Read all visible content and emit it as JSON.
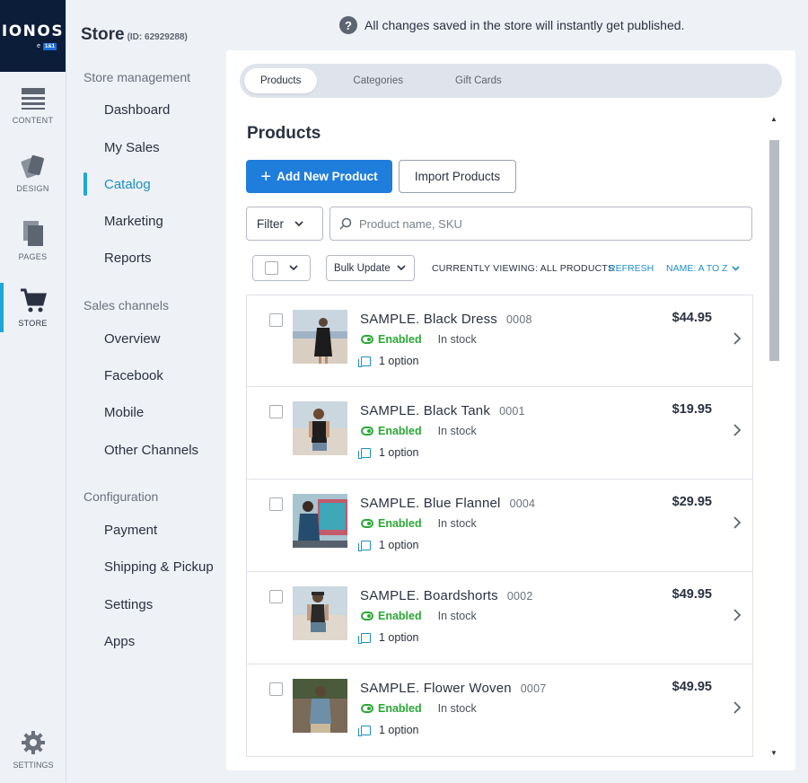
{
  "rail": {
    "logo_text": "IONOS",
    "logo_sub_prefix": "e",
    "logo_sub_badge": "1&1",
    "items": [
      {
        "label": "CONTENT",
        "icon": "content-icon"
      },
      {
        "label": "DESIGN",
        "icon": "design-icon"
      },
      {
        "label": "PAGES",
        "icon": "pages-icon"
      },
      {
        "label": "STORE",
        "icon": "cart-icon"
      }
    ],
    "settings_label": "SETTINGS"
  },
  "sidebar": {
    "title": "Store",
    "store_id": "(ID: 62929288)",
    "sections": [
      {
        "label": "Store management"
      },
      {
        "label": "Sales channels"
      },
      {
        "label": "Configuration"
      }
    ],
    "items": [
      "Dashboard",
      "My Sales",
      "Catalog",
      "Marketing",
      "Reports",
      "Overview",
      "Facebook",
      "Mobile",
      "Other Channels",
      "Payment",
      "Shipping & Pickup",
      "Settings",
      "Apps"
    ],
    "active_item": "Catalog"
  },
  "info_text": "All changes saved in the store will instantly get published.",
  "tabs": [
    "Products",
    "Categories",
    "Gift Cards"
  ],
  "page_title": "Products",
  "buttons": {
    "add": "Add New Product",
    "import": "Import Products"
  },
  "filter_label": "Filter",
  "search_placeholder": "Product name, SKU",
  "bulk_label": "Bulk Update",
  "viewing_text": "CURRENTLY VIEWING: ALL PRODUCTS",
  "refresh_label": "REFRESH",
  "sort_label": "NAME: A TO Z",
  "products": [
    {
      "name": "SAMPLE. Black Dress",
      "sku": "0008",
      "status": "Enabled",
      "stock": "In stock",
      "options": "1 option",
      "price": "$44.95"
    },
    {
      "name": "SAMPLE. Black Tank",
      "sku": "0001",
      "status": "Enabled",
      "stock": "In stock",
      "options": "1 option",
      "price": "$19.95"
    },
    {
      "name": "SAMPLE. Blue Flannel",
      "sku": "0004",
      "status": "Enabled",
      "stock": "In stock",
      "options": "1 option",
      "price": "$29.95"
    },
    {
      "name": "SAMPLE. Boardshorts",
      "sku": "0002",
      "status": "Enabled",
      "stock": "In stock",
      "options": "1 option",
      "price": "$49.95"
    },
    {
      "name": "SAMPLE. Flower Woven",
      "sku": "0007",
      "status": "Enabled",
      "stock": "In stock",
      "options": "1 option",
      "price": "$49.95"
    }
  ],
  "colors": {
    "accent": "#1f7ddb",
    "active_nav": "#1c8fc4",
    "enabled": "#2aa835",
    "logo_bg": "#0b1d39"
  }
}
